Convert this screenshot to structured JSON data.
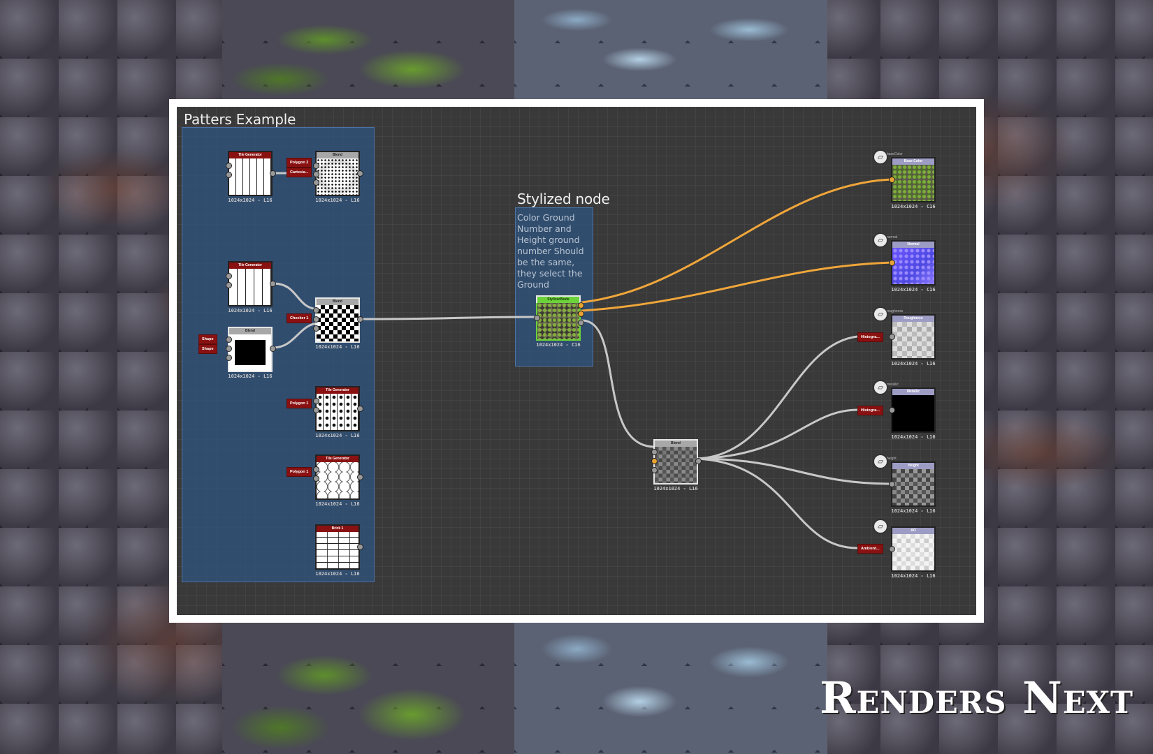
{
  "canvas": {
    "group_title": "Patters Example",
    "stylized_title": "Stylized node",
    "stylized_note": "Color Ground Number and Height ground number Should be the same, they select the Ground"
  },
  "nodes": {
    "tile_gen_1": {
      "header": "Tile Generator",
      "res": "1024x1024 - L16"
    },
    "blend_1": {
      "header": "Blend",
      "res": "1024x1024 - L16"
    },
    "tile_gen_2": {
      "header": "Tile Generator",
      "res": "1024x1024 - L16"
    },
    "blend_2": {
      "header": "Blend",
      "res": "1024x1024 - L16"
    },
    "blend_3": {
      "header": "Blend",
      "res": "1024x1024 - L16"
    },
    "tile_gen_3": {
      "header": "Tile Generator",
      "res": "1024x1024 - L16"
    },
    "tile_gen_4": {
      "header": "Tile Generator",
      "res": "1024x1024 - L16"
    },
    "brick_1": {
      "header": "Brick 1",
      "res": "1024x1024 - L16"
    },
    "stylized": {
      "header": "StylizedNode",
      "res": "1024x1024 - C16"
    },
    "blend_main": {
      "header": "Blend",
      "res": "1024x1024 - L16"
    },
    "out_basecolor": {
      "header": "Base Color",
      "res": "1024x1024 - C16",
      "label": "baseColor"
    },
    "out_normal": {
      "header": "Normal",
      "res": "1024x1024 - C16",
      "label": "normal"
    },
    "out_roughness": {
      "header": "Roughness",
      "res": "1024x1024 - L16",
      "label": "roughness"
    },
    "out_metallic": {
      "header": "Metallic",
      "res": "1024x1024 - L16",
      "label": "metallic"
    },
    "out_height": {
      "header": "Height",
      "res": "1024x1024 - L16",
      "label": "height"
    },
    "out_ao": {
      "header": "AO",
      "res": "1024x1024 - L16",
      "label": ""
    }
  },
  "tags": {
    "polygon2": "Polygon 2",
    "cartesian": "Cartesia...",
    "checker1": "Checker 1",
    "shape_a": "Shape",
    "shape_b": "Shape",
    "polygon1_a": "Polygon 1",
    "polygon1_b": "Polygon 1",
    "histogram_a": "Histogra...",
    "histogram_b": "Histogra...",
    "ambient": "Ambient..."
  },
  "logo": "Renders Next",
  "colors": {
    "canvas_bg": "#393939",
    "group_bg": "#2e5482",
    "wire_orange": "#f0a63a",
    "wire_gray": "#c8c8c8",
    "tag_red": "#8a1111"
  }
}
